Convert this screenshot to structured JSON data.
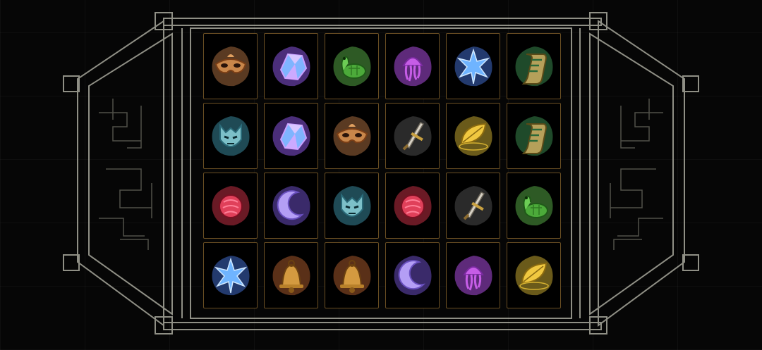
{
  "board": {
    "rows": [
      [
        {
          "item": "mask-icon",
          "color": "#5a3a22"
        },
        {
          "item": "crystal-icon",
          "color": "#4b2e7a"
        },
        {
          "item": "turtle-icon",
          "color": "#2e5a25"
        },
        {
          "item": "jellyfish-icon",
          "color": "#5e2a7a"
        },
        {
          "item": "star-icon",
          "color": "#233a6e"
        },
        {
          "item": "scroll-icon",
          "color": "#1f4a2a"
        }
      ],
      [
        {
          "item": "demon-mask-icon",
          "color": "#1f4a55"
        },
        {
          "item": "crystal-icon",
          "color": "#4b2e7a"
        },
        {
          "item": "mask-icon",
          "color": "#5a3a22"
        },
        {
          "item": "dagger-icon",
          "color": "#2a2a2a"
        },
        {
          "item": "leaf-icon",
          "color": "#6a5a1a"
        },
        {
          "item": "scroll-icon",
          "color": "#1f4a2a"
        }
      ],
      [
        {
          "item": "rose-icon",
          "color": "#6a1a25"
        },
        {
          "item": "moon-icon",
          "color": "#3a2a6a"
        },
        {
          "item": "demon-mask-icon",
          "color": "#1f4a55"
        },
        {
          "item": "rose-icon",
          "color": "#6a1a25"
        },
        {
          "item": "dagger-icon",
          "color": "#2a2a2a"
        },
        {
          "item": "turtle-icon",
          "color": "#2e5a25"
        }
      ],
      [
        {
          "item": "star-icon",
          "color": "#233a6e"
        },
        {
          "item": "bell-icon",
          "color": "#5a3018"
        },
        {
          "item": "bell-icon",
          "color": "#5a3018"
        },
        {
          "item": "moon-icon",
          "color": "#3a2a6a"
        },
        {
          "item": "jellyfish-icon",
          "color": "#5e2a7a"
        },
        {
          "item": "leaf-icon",
          "color": "#6a5a1a"
        }
      ]
    ]
  }
}
